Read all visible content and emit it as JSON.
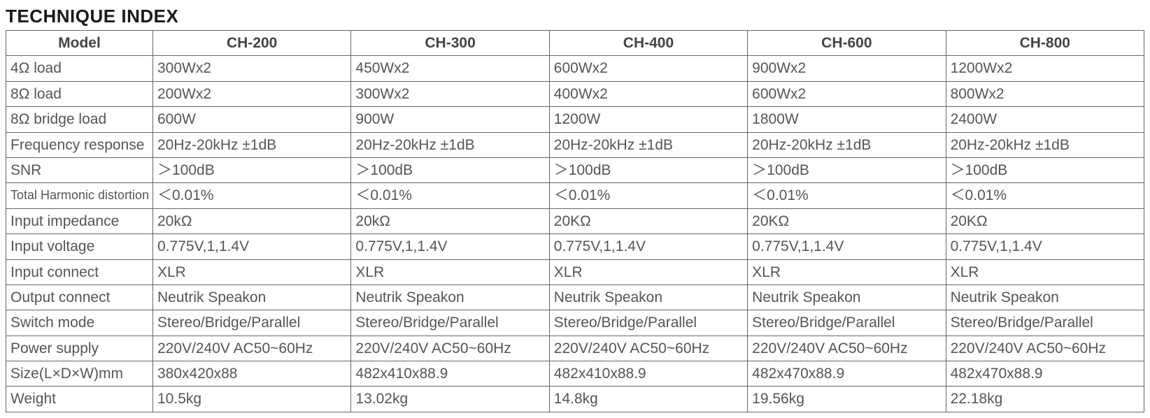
{
  "title": "TECHNIQUE INDEX",
  "chart_data": {
    "type": "table",
    "columns": [
      "Model",
      "CH-200",
      "CH-300",
      "CH-400",
      "CH-600",
      "CH-800"
    ],
    "rows": [
      {
        "label": "4Ω load",
        "values": [
          "300Wx2",
          "450Wx2",
          "600Wx2",
          "900Wx2",
          "1200Wx2"
        ]
      },
      {
        "label": "8Ω load",
        "values": [
          "200Wx2",
          "300Wx2",
          "400Wx2",
          "600Wx2",
          "800Wx2"
        ]
      },
      {
        "label": "8Ω bridge load",
        "values": [
          "600W",
          "900W",
          "1200W",
          "1800W",
          "2400W"
        ]
      },
      {
        "label": "Frequency response",
        "values": [
          "20Hz-20kHz ±1dB",
          "20Hz-20kHz ±1dB",
          "20Hz-20kHz ±1dB",
          "20Hz-20kHz ±1dB",
          "20Hz-20kHz ±1dB"
        ]
      },
      {
        "label": "SNR",
        "values": [
          "＞100dB",
          "＞100dB",
          "＞100dB",
          "＞100dB",
          "＞100dB"
        ]
      },
      {
        "label": "Total Harmonic distortion",
        "values": [
          "＜0.01%",
          "＜0.01%",
          "＜0.01%",
          "＜0.01%",
          "＜0.01%"
        ]
      },
      {
        "label": "Input impedance",
        "values": [
          "20kΩ",
          "20kΩ",
          "20KΩ",
          "20KΩ",
          "20KΩ"
        ]
      },
      {
        "label": "Input voltage",
        "values": [
          "0.775V,1,1.4V",
          "0.775V,1,1.4V",
          "0.775V,1,1.4V",
          "0.775V,1,1.4V",
          "0.775V,1,1.4V"
        ]
      },
      {
        "label": "Input connect",
        "values": [
          "XLR",
          "XLR",
          "XLR",
          "XLR",
          "XLR"
        ]
      },
      {
        "label": "Output connect",
        "values": [
          "Neutrik Speakon",
          "Neutrik Speakon",
          "Neutrik Speakon",
          "Neutrik Speakon",
          "Neutrik Speakon"
        ]
      },
      {
        "label": "Switch mode",
        "values": [
          "Stereo/Bridge/Parallel",
          "Stereo/Bridge/Parallel",
          "Stereo/Bridge/Parallel",
          "Stereo/Bridge/Parallel",
          "Stereo/Bridge/Parallel"
        ]
      },
      {
        "label": "Power supply",
        "values": [
          "220V/240V AC50~60Hz",
          "220V/240V AC50~60Hz",
          "220V/240V AC50~60Hz",
          "220V/240V AC50~60Hz",
          "220V/240V AC50~60Hz"
        ]
      },
      {
        "label": "Size(L×D×W)mm",
        "values": [
          "380x420x88",
          "482x410x88.9",
          "482x410x88.9",
          "482x470x88.9",
          "482x470x88.9"
        ]
      },
      {
        "label": "Weight",
        "values": [
          "10.5kg",
          "13.02kg",
          "14.8kg",
          "19.56kg",
          "22.18kg"
        ]
      }
    ]
  }
}
